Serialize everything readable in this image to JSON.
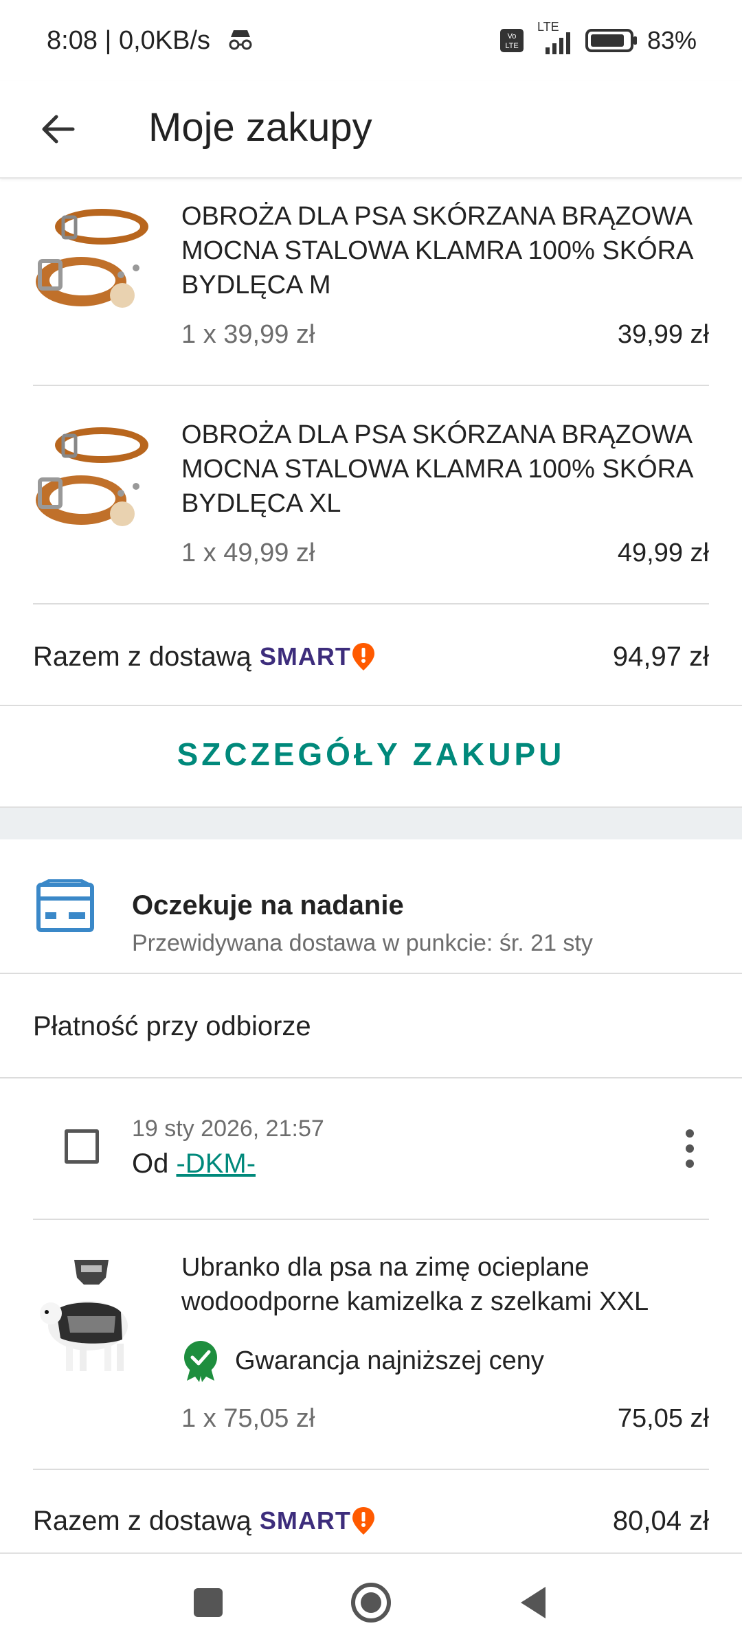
{
  "status_bar": {
    "time": "8:08 | 0,0KB/s",
    "network": "LTE",
    "battery": "83%"
  },
  "header": {
    "title": "Moje zakupy"
  },
  "purchase1": {
    "items": [
      {
        "name": "OBROŻA DLA PSA SKÓRZANA BRĄZOWA MOCNA STALOWA KLAMRA 100% SKÓRA BYDLĘCA M",
        "qty_price": "1 x 39,99 zł",
        "total": "39,99 zł"
      },
      {
        "name": "OBROŻA DLA PSA SKÓRZANA BRĄZOWA MOCNA STALOWA KLAMRA 100% SKÓRA BYDLĘCA XL",
        "qty_price": "1 x 49,99 zł",
        "total": "49,99 zł"
      }
    ],
    "total_label": "Razem z dostawą",
    "smart_label": "SMART",
    "total_value": "94,97 zł",
    "details_button": "SZCZEGÓŁY ZAKUPU"
  },
  "purchase2": {
    "shipping_status": "Oczekuje na nadanie",
    "shipping_sub": "Przewidywana dostawa w punkcie: śr. 21 sty",
    "payment": "Płatność przy odbiorze",
    "order_date": "19 sty 2026, 21:57",
    "seller_prefix": "Od",
    "seller_name": "-DKM-",
    "items": [
      {
        "name": "Ubranko dla psa na zimę ocieplane wodoodporne kamizelka z szelkami XXL",
        "guarantee": "Gwarancja najniższej ceny",
        "qty_price": "1 x 75,05 zł",
        "total": "75,05 zł"
      }
    ],
    "total_label": "Razem z dostawą",
    "smart_label": "SMART",
    "total_value": "80,04 zł"
  },
  "colors": {
    "accent": "#00897b",
    "smart_purple": "#3d2d7c",
    "smart_orange": "#ff5a00",
    "guarantee_green": "#1e8e3e",
    "shipping_blue": "#3a88c8"
  }
}
